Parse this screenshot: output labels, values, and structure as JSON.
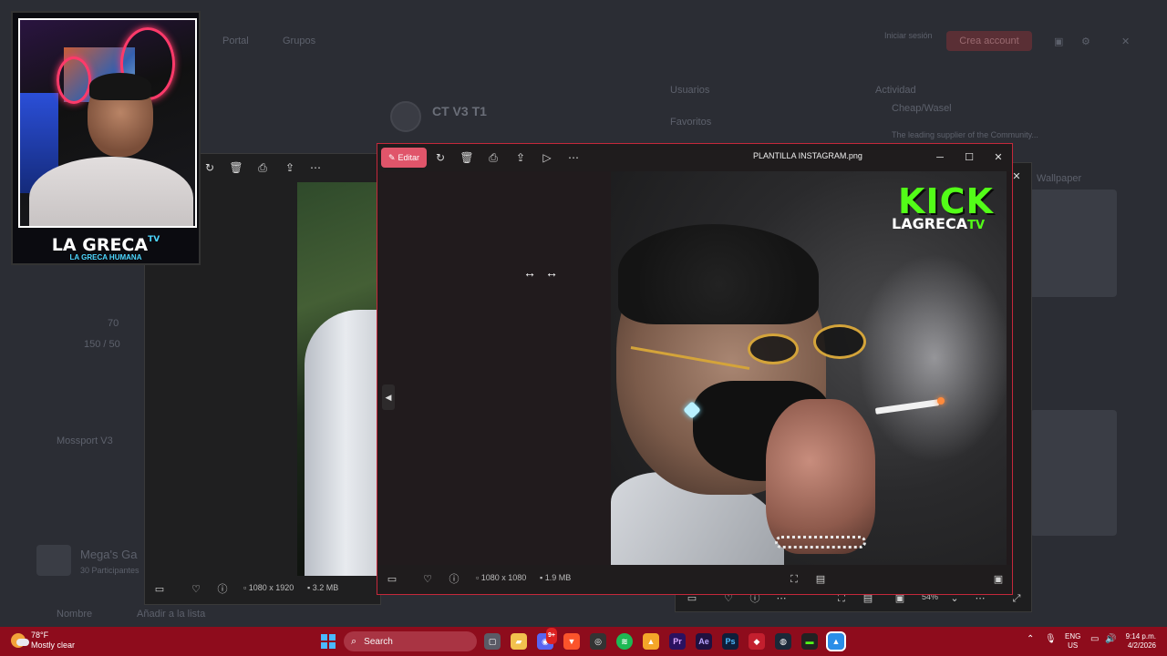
{
  "background_page": {
    "nav_items": [
      "Portal",
      "Grupos"
    ],
    "header_button": "Iniciar sesión",
    "create_account": "Crea account",
    "title": "CT V3 T1",
    "menu_right": [
      "Usuarios",
      "Favoritos"
    ],
    "side_label": "Actividad",
    "stats": [
      "70",
      "150 / 50"
    ],
    "section": "Mossport V3",
    "post_title": "Mega's Ga",
    "post_meta": "30 Participantes",
    "bottom_buttons": [
      "Nombre",
      "Añadir a la lista"
    ],
    "right_heading": "Cheap/Wasel",
    "right_text": "The leading supplier of the Community...",
    "right_link": "Wallpaper"
  },
  "back_window": {
    "dimensions": "1080 x 1920",
    "size": "3.2 MB"
  },
  "back_window2": {
    "zoom": "54%"
  },
  "main_window": {
    "edit_label": "Editar",
    "title": "PLANTILLA INSTAGRAM.png",
    "dimensions": "1080 x 1080",
    "size": "1.9 MB",
    "image_brand": "KICK",
    "image_channel": "LAGRECA",
    "image_channel_tv": "TV"
  },
  "webcam": {
    "name": "LA GRECA",
    "name_tv": "TV",
    "subtitle": "LA GRECA HUMANA"
  },
  "taskbar": {
    "temperature": "78°F",
    "condition": "Mostly clear",
    "search_label": "Search",
    "lang_top": "ENG",
    "lang_bottom": "US",
    "time": "9:14 p.m.",
    "date": "4/2/2026",
    "discord_badge": "9+",
    "apps": [
      "Pr",
      "Ae",
      "Ps"
    ]
  },
  "colors": {
    "taskbar": "#8e0c1c",
    "accent": "#e0556a",
    "kick_green": "#53fc18"
  }
}
